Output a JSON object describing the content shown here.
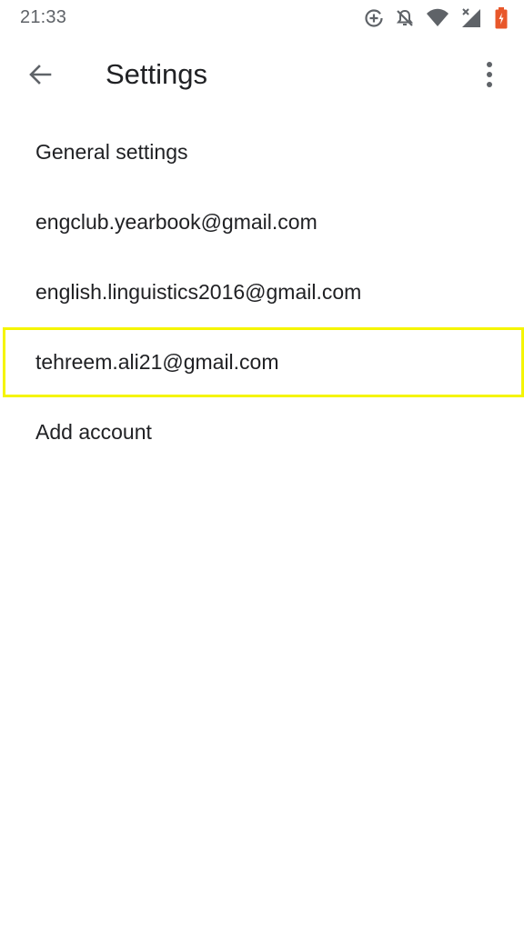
{
  "status_bar": {
    "time": "21:33",
    "icons": [
      "data-saver-icon",
      "notifications-off-icon",
      "wifi-icon",
      "cellular-signal-icon",
      "battery-icon"
    ],
    "battery_color": "#e8572a"
  },
  "app_bar": {
    "title": "Settings",
    "back_icon": "arrow-back-icon",
    "overflow_icon": "more-vert-icon"
  },
  "settings": {
    "items": [
      {
        "label": "General settings"
      },
      {
        "label": "engclub.yearbook@gmail.com"
      },
      {
        "label": "english.linguistics2016@gmail.com"
      },
      {
        "label": "tehreem.ali21@gmail.com",
        "highlighted": true
      },
      {
        "label": "Add account"
      }
    ]
  },
  "colors": {
    "highlight": "#f5f500",
    "text": "#202124",
    "icon": "#5f6368"
  }
}
